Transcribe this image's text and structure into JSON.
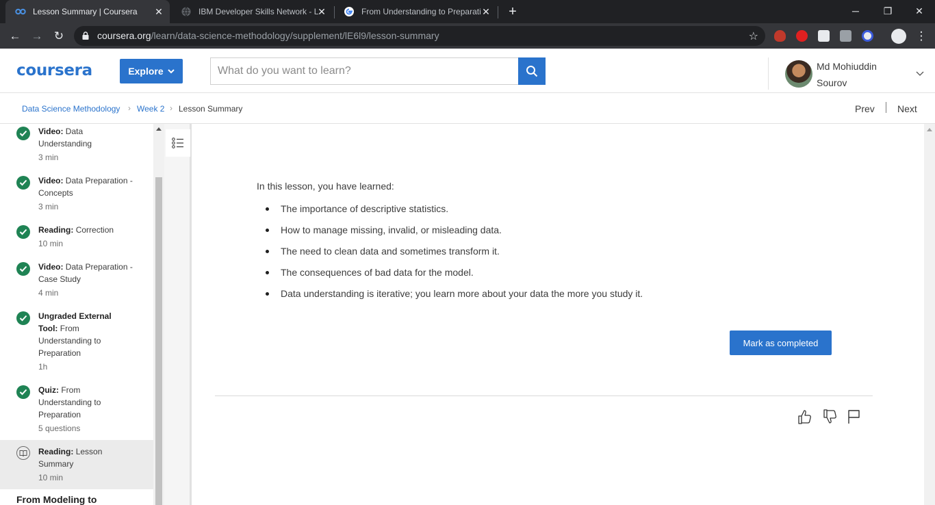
{
  "browser": {
    "tabs": [
      {
        "title": "Lesson Summary | Coursera",
        "favicon": "coursera-icon"
      },
      {
        "title": "IBM Developer Skills Network - L",
        "favicon": "globe-icon"
      },
      {
        "title": "From Understanding to Preparati",
        "favicon": "google-icon"
      }
    ],
    "url_host": "coursera.org",
    "url_path": "/learn/data-science-methodology/supplement/lE6l9/lesson-summary"
  },
  "header": {
    "logo": "coursera",
    "explore_label": "Explore",
    "search_placeholder": "What do you want to learn?",
    "user_name_line1": "Md Mohiuddin",
    "user_name_line2": "Sourov"
  },
  "breadcrumb": {
    "course": "Data Science Methodology",
    "week": "Week 2",
    "current": "Lesson Summary",
    "prev": "Prev",
    "next": "Next"
  },
  "sidebar": {
    "items": [
      {
        "type": "Video:",
        "title_line1": "Data",
        "title_line2": "Understanding",
        "duration": "3 min"
      },
      {
        "type": "Video:",
        "title_line1": "Data Preparation -",
        "title_line2": "Concepts",
        "duration": "3 min"
      },
      {
        "type": "Reading:",
        "title_line1": "Correction",
        "duration": "10 min"
      },
      {
        "type": "Video:",
        "title_line1": "Data Preparation -",
        "title_line2": "Case Study",
        "duration": "4 min"
      },
      {
        "type_line1": "Ungraded External",
        "type_line2": "Tool:",
        "title_line2": "From",
        "title_line3": "Understanding to",
        "title_line4": "Preparation",
        "duration": "1h"
      },
      {
        "type": "Quiz:",
        "title_line1": "From",
        "title_line2": "Understanding to",
        "title_line3": "Preparation",
        "duration": "5 questions"
      },
      {
        "type": "Reading:",
        "title_line1": "Lesson",
        "title_line2": "Summary",
        "duration": "10 min"
      }
    ],
    "next_module": "From Modeling to"
  },
  "content": {
    "intro": "In this lesson, you have learned:",
    "bullets": [
      "The importance of descriptive statistics.",
      "How to manage missing, invalid, or misleading data.",
      "The need to clean data and sometimes transform it.",
      "The consequences of bad data for the model.",
      "Data understanding is iterative; you learn more about your data the more you study it."
    ],
    "mark_completed": "Mark as completed"
  },
  "colors": {
    "brand": "#2a73cc",
    "complete_check": "#1f8354"
  }
}
